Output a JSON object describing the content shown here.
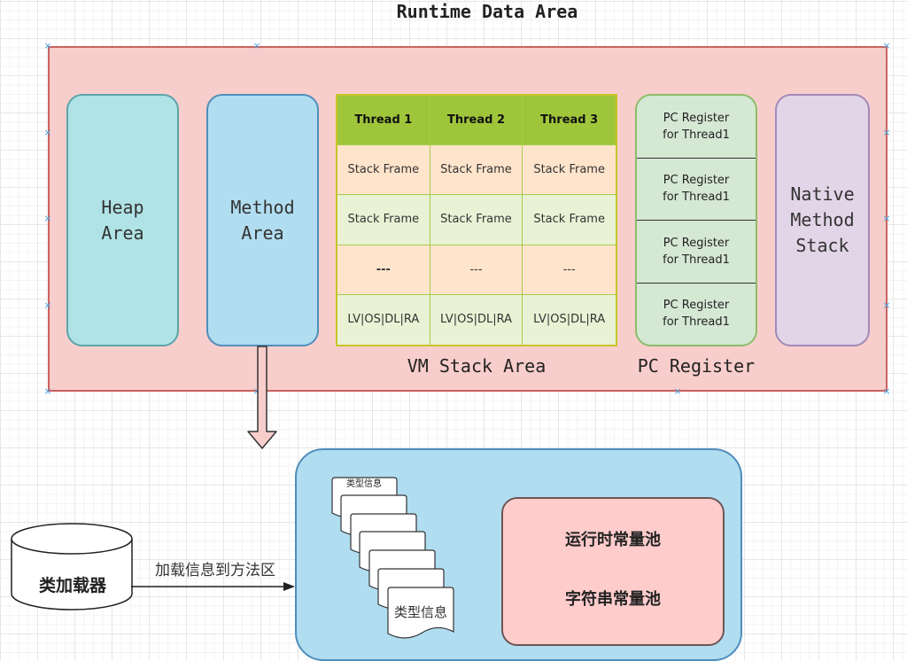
{
  "title": "Runtime Data Area",
  "runtime_area": {
    "heap_label": "Heap\nArea",
    "method_label": "Method\nArea",
    "native_label": "Native\nMethod\nStack",
    "vm_stack": {
      "label": "VM Stack Area",
      "headers": [
        "Thread 1",
        "Thread 2",
        "Thread 3"
      ],
      "rows": [
        [
          "Stack Frame",
          "Stack Frame",
          "Stack Frame"
        ],
        [
          "Stack Frame",
          "Stack Frame",
          "Stack Frame"
        ],
        [
          "---",
          "---",
          "---"
        ],
        [
          "LV|OS|DL|RA",
          "LV|OS|DL|RA",
          "LV|OS|DL|RA"
        ]
      ]
    },
    "pc_register": {
      "label": "PC Register",
      "cells": [
        "PC Register\nfor  Thread1",
        "PC Register\nfor  Thread1",
        "PC Register\nfor  Thread1",
        "PC Register\nfor  Thread1"
      ]
    }
  },
  "class_loader": {
    "label": "类加载器",
    "edge_label": "加载信息到方法区"
  },
  "method_area_detail": {
    "type_info_top": "类型信息",
    "type_info_bottom": "类型信息",
    "runtime_constant_pool": "运行时常量池",
    "string_constant_pool": "字符串常量池"
  },
  "colors": {
    "runtime_fill": "#f8cecc",
    "runtime_stroke": "#c96360",
    "heap_fill": "#b0e3e6",
    "method_fill": "#b1ddf0",
    "native_fill": "#e1d5e7",
    "pc_fill": "#d5e8d4",
    "thread_header": "#9fc63a",
    "pool_fill": "#ffcccc"
  }
}
